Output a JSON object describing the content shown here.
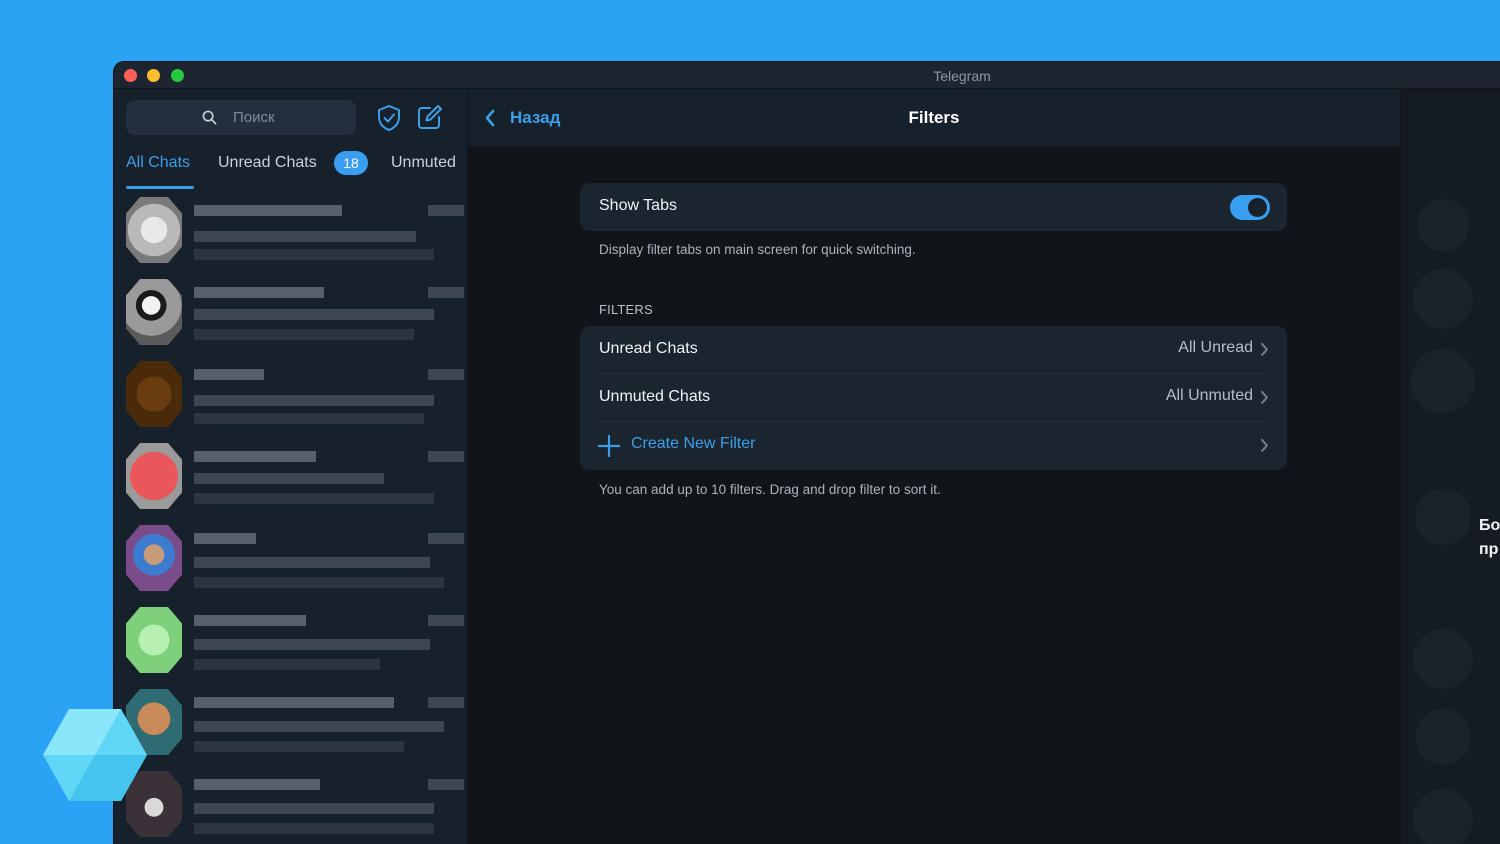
{
  "window": {
    "title": "Telegram"
  },
  "sidebar": {
    "search_placeholder": "Поиск",
    "tabs": [
      {
        "label": "All Chats",
        "active": true
      },
      {
        "label": "Unread Chats",
        "badge": "18"
      },
      {
        "label": "Unmuted"
      }
    ]
  },
  "header": {
    "back_label": "Назад",
    "title": "Filters"
  },
  "settings": {
    "show_tabs": {
      "label": "Show Tabs",
      "enabled": true
    },
    "show_tabs_hint": "Display filter tabs on main screen for quick switching.",
    "filters_section": "FILTERS",
    "filters": [
      {
        "label": "Unread Chats",
        "value": "All Unread"
      },
      {
        "label": "Unmuted Chats",
        "value": "All Unmuted"
      }
    ],
    "create_label": "Create New Filter",
    "filters_hint": "You can add up to 10 filters. Drag and drop filter to sort it."
  },
  "right_panel": {
    "line1": "Бо",
    "line2": "пр"
  },
  "colors": {
    "accent": "#3d9ee8",
    "background": "#2aa3f5",
    "panel": "#17212b"
  },
  "icons": [
    "search-icon",
    "shield-icon",
    "compose-icon",
    "chevron-left-icon",
    "chevron-right-icon",
    "plus-icon"
  ]
}
